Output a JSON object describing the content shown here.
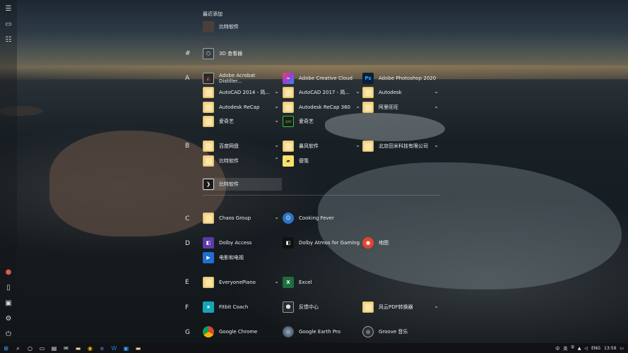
{
  "recent": {
    "title": "最近添加",
    "items": [
      {
        "label": "比特软件",
        "icon": "blank-icon"
      }
    ]
  },
  "groups": [
    {
      "letter": "#",
      "apps": [
        {
          "label": "3D 查看器",
          "icon": "cube-icon"
        }
      ]
    },
    {
      "letter": "A",
      "apps": [
        {
          "label": "Adobe Acrobat Distiller...",
          "icon": "acrobat-icon"
        },
        {
          "label": "Adobe Creative Cloud",
          "icon": "creative-cloud-icon"
        },
        {
          "label": "Adobe Photoshop 2020",
          "icon": "photoshop-icon",
          "glyph": "Ps"
        },
        {
          "label": "AutoCAD 2014 - 简...",
          "icon": "folder-icon",
          "expand": true
        },
        {
          "label": "AutoCAD 2017 - 简...",
          "icon": "folder-icon",
          "expand": true
        },
        {
          "label": "Autodesk",
          "icon": "folder-icon",
          "expand": true
        },
        {
          "label": "Autodesk ReCap",
          "icon": "folder-icon",
          "expand": true
        },
        {
          "label": "Autodesk ReCap 360",
          "icon": "folder-icon",
          "expand": true
        },
        {
          "label": "阿里旺旺",
          "icon": "folder-icon",
          "expand": true
        },
        {
          "label": "爱奇艺",
          "icon": "folder-icon",
          "expand": true
        },
        {
          "label": "爱奇艺",
          "icon": "iqiyi-icon",
          "glyph": "iQIYI"
        }
      ]
    },
    {
      "letter": "B",
      "apps": [
        {
          "label": "百度网盘",
          "icon": "folder-icon",
          "expand": true
        },
        {
          "label": "暴风软件",
          "icon": "folder-icon",
          "expand": true
        },
        {
          "label": "北京田米科技有限公司",
          "icon": "folder-icon",
          "expand": true
        },
        {
          "label": "比特软件",
          "icon": "folder-icon",
          "expand": true,
          "open": true
        },
        {
          "label": "便笺",
          "icon": "sticky-notes-icon"
        },
        {
          "label": "比特软件",
          "icon": "bit-software-icon"
        }
      ]
    },
    {
      "letter": "C",
      "apps": [
        {
          "label": "Chaos Group",
          "icon": "folder-icon",
          "expand": true
        },
        {
          "label": "Cooking Fever",
          "icon": "cooking-fever-icon"
        }
      ]
    },
    {
      "letter": "D",
      "apps": [
        {
          "label": "Dolby Access",
          "icon": "dolby-icon"
        },
        {
          "label": "Dolby Atmos for Gaming",
          "icon": "dolby-atmos-icon"
        },
        {
          "label": "地图",
          "icon": "maps-icon"
        },
        {
          "label": "电影和电视",
          "icon": "movies-tv-icon"
        }
      ]
    },
    {
      "letter": "E",
      "apps": [
        {
          "label": "EveryonePiano",
          "icon": "folder-icon",
          "expand": true
        },
        {
          "label": "Excel",
          "icon": "excel-icon",
          "glyph": "X"
        }
      ]
    },
    {
      "letter": "F",
      "apps": [
        {
          "label": "Fitbit Coach",
          "icon": "fitbit-icon"
        },
        {
          "label": "反馈中心",
          "icon": "feedback-hub-icon"
        },
        {
          "label": "风云PDF转换器",
          "icon": "folder-icon",
          "expand": true
        }
      ]
    },
    {
      "letter": "G",
      "apps": [
        {
          "label": "Google Chrome",
          "icon": "chrome-icon"
        },
        {
          "label": "Google Earth Pro",
          "icon": "google-earth-icon"
        },
        {
          "label": "Groove 音乐",
          "icon": "groove-icon"
        }
      ]
    }
  ],
  "taskbar": {
    "time": "13:59",
    "ime": "中",
    "ime2": "英",
    "lang": "ENG"
  },
  "colors": {
    "folder": "#f3d58d",
    "taskbar": "#101216",
    "accent": "#1f6fd0"
  }
}
